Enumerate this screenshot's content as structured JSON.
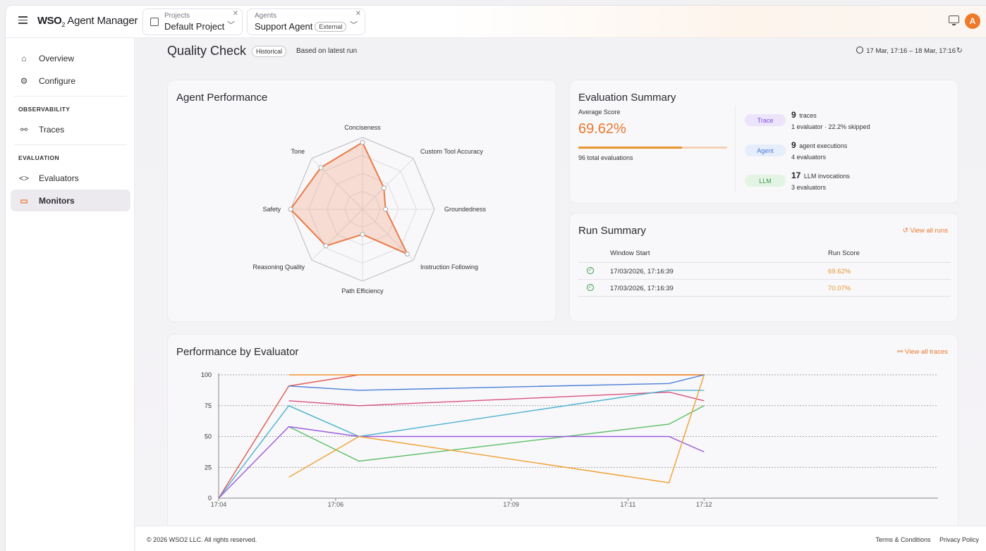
{
  "topbar": {
    "logo_prefix": "WSO",
    "logo_sub": "2",
    "logo_suffix": " Agent Manager",
    "projects": {
      "caption": "Projects",
      "value": "Default Project"
    },
    "agents": {
      "caption": "Agents",
      "value": "Support Agent",
      "badge": "External"
    },
    "avatar_initial": "A"
  },
  "sidebar": {
    "items_top": [
      {
        "label": "Overview",
        "icon": "home-icon"
      },
      {
        "label": "Configure",
        "icon": "gear-icon"
      }
    ],
    "section_observability": "OBSERVABILITY",
    "traces": {
      "label": "Traces",
      "icon": "traces-icon"
    },
    "section_evaluation": "EVALUATION",
    "evaluators": {
      "label": "Evaluators",
      "icon": "code-icon"
    },
    "monitors": {
      "label": "Monitors",
      "icon": "monitor-icon"
    }
  },
  "header": {
    "title": "Quality Check",
    "badge": "Historical",
    "subtitle": "Based on latest run",
    "time_range": "17 Mar, 17:16 – 18 Mar, 17:16"
  },
  "agent_performance": {
    "title": "Agent Performance",
    "axes": [
      "Conciseness",
      "Custom Tool Accuracy",
      "Groundedness",
      "Instruction Following",
      "Path Efficiency",
      "Reasoning Quality",
      "Safety",
      "Tone"
    ],
    "scores": [
      0.93,
      0.42,
      0.32,
      0.88,
      0.35,
      0.72,
      1.0,
      0.82
    ]
  },
  "evaluation_summary": {
    "title": "Evaluation Summary",
    "avg_label": "Average Score",
    "avg_score": "69.62%",
    "avg_fraction": 0.6962,
    "total": "96 total evaluations",
    "levels": [
      {
        "pill": "Trace",
        "count": "9",
        "unit": "traces",
        "sub": "1 evaluator · 22.2% skipped",
        "bg": "#ece4fb",
        "fg": "#7b4fd6"
      },
      {
        "pill": "Agent",
        "count": "9",
        "unit": "agent executions",
        "sub": "4 evaluators",
        "bg": "#e6edfb",
        "fg": "#4b78d9"
      },
      {
        "pill": "LLM",
        "count": "17",
        "unit": "LLM invocations",
        "sub": "3 evaluators",
        "bg": "#e3f4e5",
        "fg": "#3c9a4c"
      }
    ]
  },
  "run_summary": {
    "title": "Run Summary",
    "view_all": "View all runs",
    "columns": [
      "Window Start",
      "Run Score"
    ],
    "rows": [
      {
        "window_start": "17/03/2026, 17:16:39",
        "score": "69.62%"
      },
      {
        "window_start": "17/03/2026, 17:16:39",
        "score": "70.07%"
      }
    ]
  },
  "performance_by_evaluator": {
    "title": "Performance by Evaluator",
    "view_all": "View all traces"
  },
  "chart_data": {
    "type": "line",
    "title": "Performance by Evaluator",
    "xlabel": "",
    "ylabel": "",
    "ylim": [
      0,
      100
    ],
    "yticks": [
      0,
      25,
      50,
      75,
      100
    ],
    "xrange_min": [
      244,
      256.3
    ],
    "xticks": [
      {
        "label": "17:04",
        "t": 244.0
      },
      {
        "label": "17:06",
        "t": 246.0
      },
      {
        "label": "17:09",
        "t": 249.0
      },
      {
        "label": "17:11",
        "t": 251.0
      },
      {
        "label": "17:12",
        "t": 252.3
      }
    ],
    "x_unit": "minutes after 13:00",
    "grid": "horizontal dashed",
    "series": [
      {
        "color": "#e05a4f",
        "points": [
          [
            244.0,
            0
          ],
          [
            245.2,
            91
          ],
          [
            246.4,
            100
          ],
          [
            252.3,
            100
          ]
        ]
      },
      {
        "color": "#f0922b",
        "points": [
          [
            245.2,
            100
          ],
          [
            252.3,
            100
          ]
        ]
      },
      {
        "color": "#4a7fd9",
        "points": [
          [
            245.2,
            91
          ],
          [
            246.4,
            87.5
          ],
          [
            251.7,
            93
          ],
          [
            252.3,
            100
          ]
        ]
      },
      {
        "color": "#d9527e",
        "points": [
          [
            245.2,
            79
          ],
          [
            246.4,
            75
          ],
          [
            251.7,
            86
          ],
          [
            252.3,
            79
          ]
        ]
      },
      {
        "color": "#4ab2cf",
        "points": [
          [
            244.0,
            0
          ],
          [
            245.2,
            75
          ],
          [
            246.4,
            50
          ],
          [
            251.7,
            87.5
          ],
          [
            252.3,
            87.5
          ]
        ]
      },
      {
        "color": "#5bbf65",
        "points": [
          [
            245.2,
            58
          ],
          [
            246.4,
            30
          ],
          [
            251.7,
            60
          ],
          [
            252.3,
            75
          ]
        ]
      },
      {
        "color": "#9b5ae0",
        "points": [
          [
            244.0,
            0
          ],
          [
            245.2,
            58
          ],
          [
            246.4,
            50
          ],
          [
            251.7,
            50
          ],
          [
            252.3,
            37.5
          ]
        ]
      },
      {
        "color": "#f0a030",
        "points": [
          [
            245.2,
            17
          ],
          [
            246.4,
            50
          ],
          [
            251.7,
            12.5
          ],
          [
            252.3,
            100
          ]
        ]
      }
    ]
  },
  "footer": {
    "copyright": "© 2026 WSO2 LLC. All rights reserved.",
    "terms": "Terms & Conditions",
    "privacy": "Privacy Policy"
  }
}
